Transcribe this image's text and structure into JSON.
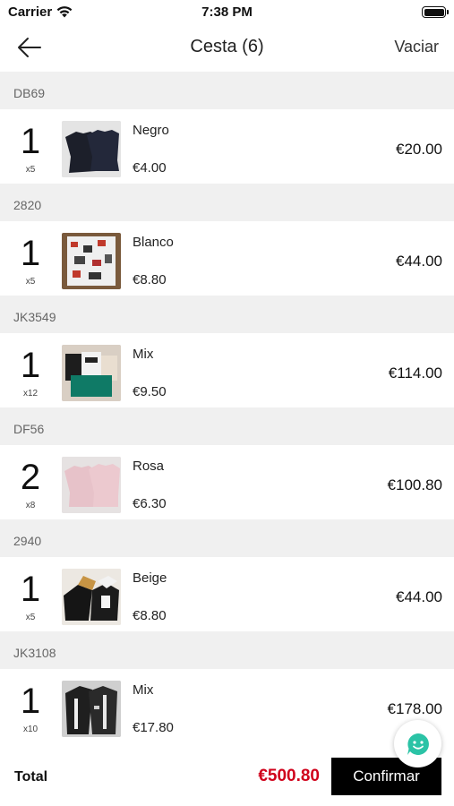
{
  "status_bar": {
    "carrier": "Carrier",
    "time": "7:38 PM"
  },
  "nav": {
    "title": "Cesta (6)",
    "action": "Vaciar"
  },
  "groups": [
    {
      "code": "DB69",
      "qty": "1",
      "multiplier": "x5",
      "variant": "Negro",
      "unit_price": "€4.00",
      "line_total": "€20.00",
      "thumb": "black-sweaters"
    },
    {
      "code": "2820",
      "qty": "1",
      "multiplier": "x5",
      "variant": "Blanco",
      "unit_price": "€8.80",
      "line_total": "€44.00",
      "thumb": "printed-shirts"
    },
    {
      "code": "JK3549",
      "qty": "1",
      "multiplier": "x12",
      "variant": "Mix",
      "unit_price": "€9.50",
      "line_total": "€114.00",
      "thumb": "mixed-hoodies"
    },
    {
      "code": "DF56",
      "qty": "2",
      "multiplier": "x8",
      "variant": "Rosa",
      "unit_price": "€6.30",
      "line_total": "€100.80",
      "thumb": "pink-sweaters"
    },
    {
      "code": "2940",
      "qty": "1",
      "multiplier": "x5",
      "variant": "Beige",
      "unit_price": "€8.80",
      "line_total": "€44.00",
      "thumb": "beige-jackets"
    },
    {
      "code": "JK3108",
      "qty": "1",
      "multiplier": "x10",
      "variant": "Mix",
      "unit_price": "€17.80",
      "line_total": "€178.00",
      "thumb": "dark-jackets"
    }
  ],
  "footer": {
    "total_label": "Total",
    "total_value": "€500.80",
    "confirm_label": "Confirmar"
  },
  "colors": {
    "accent": "#d0021b",
    "button": "#000000",
    "chat": "#2bc3a6",
    "group_bg": "#f0f0f0"
  }
}
